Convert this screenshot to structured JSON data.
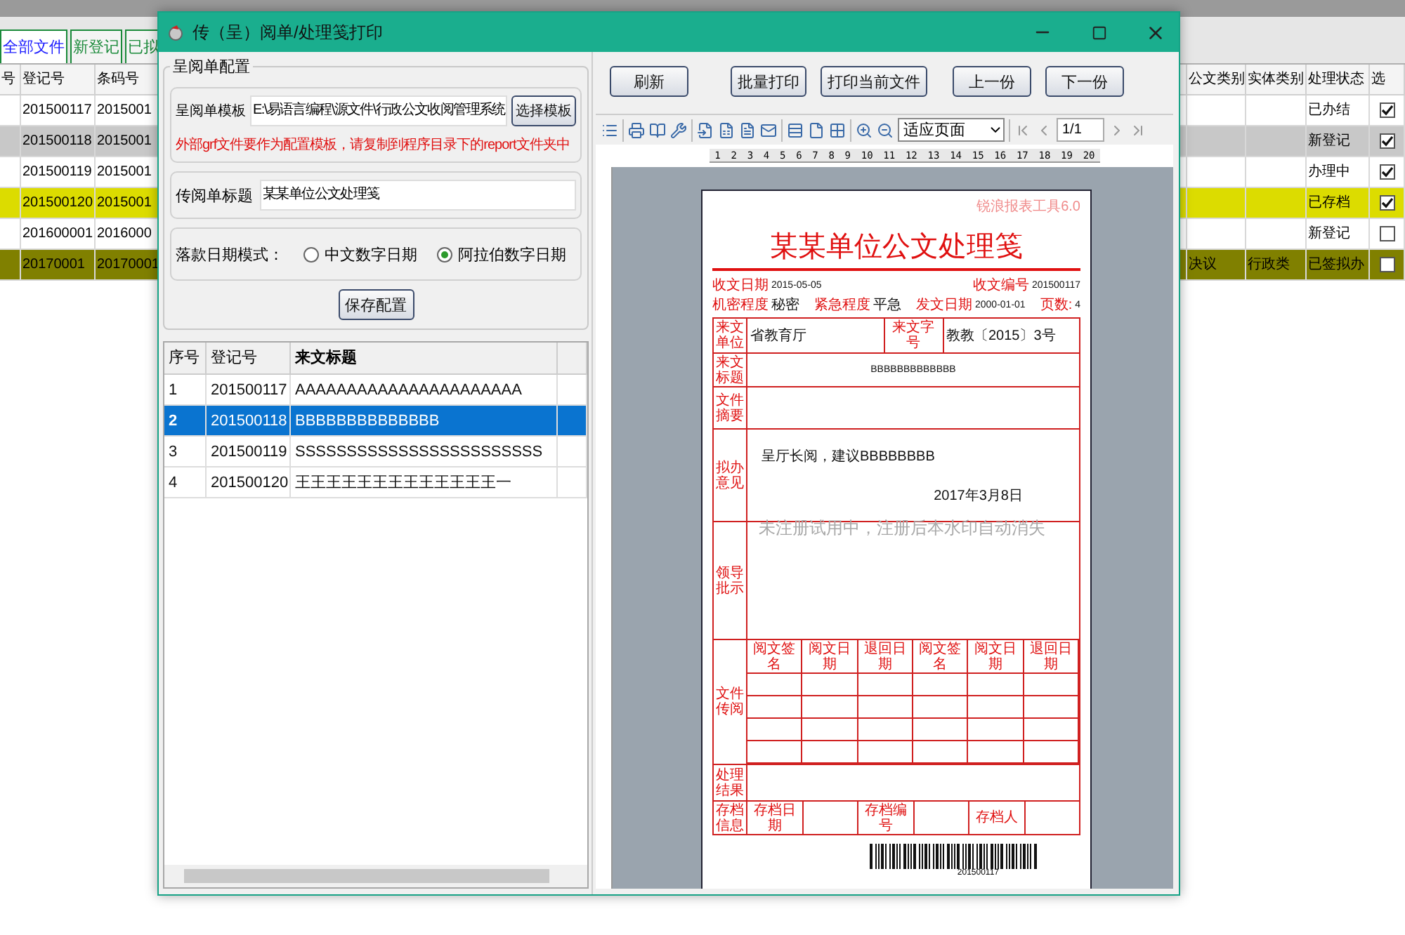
{
  "background_app": {
    "tabs": [
      {
        "label": "全部文件",
        "selected": true
      },
      {
        "label": "新登记",
        "selected": false
      },
      {
        "label": "已拟",
        "selected": false
      }
    ],
    "left_columns": [
      "号",
      "登记号",
      "条码号"
    ],
    "right_columns": [
      "公文类别",
      "实体类别",
      "处理状态",
      "选"
    ],
    "rows": [
      {
        "color": "#ffffff",
        "reg_no": "201500117",
        "barcode": "2015001",
        "status": "已办结",
        "checked": true
      },
      {
        "color": "#c8c8c8",
        "reg_no": "201500118",
        "barcode": "2015001",
        "status": "新登记",
        "checked": true
      },
      {
        "color": "#ffffff",
        "reg_no": "201500119",
        "barcode": "2015001",
        "status": "办理中",
        "checked": true
      },
      {
        "color": "#dcdc00",
        "reg_no": "201500120",
        "barcode": "2015001",
        "status": "已存档",
        "checked": true
      },
      {
        "color": "#ffffff",
        "reg_no": "201600001",
        "barcode": "2016000",
        "status": "新登记",
        "checked": false
      },
      {
        "color": "#808000",
        "reg_no": "20170001",
        "barcode": "20170001",
        "doc_category": "决议",
        "entity_category": "行政类",
        "status": "已签拟办",
        "checked": false
      }
    ]
  },
  "dialog": {
    "title": "传（呈）阅单/处理笺打印",
    "config": {
      "group_title": "呈阅单配置",
      "template_label": "呈阅单模板",
      "template_path": "E:\\易语言编程\\源文件\\行政公文收阅管理系统",
      "select_button": "选择模板",
      "hint": "外部grf文件要作为配置模板，请复制到程序目录下的report文件夹中",
      "title_label": "传阅单标题",
      "title_value": "某某单位公文处理笺",
      "date_mode_label": "落款日期模式：",
      "date_modes": [
        {
          "label": "中文数字日期",
          "selected": false
        },
        {
          "label": "阿拉伯数字日期",
          "selected": true
        }
      ],
      "save_button": "保存配置"
    },
    "list": {
      "columns": [
        "序号",
        "登记号",
        "来文标题"
      ],
      "rows": [
        {
          "index": "1",
          "reg_no": "201500117",
          "title": "AAAAAAAAAAAAAAAAAAAAAA",
          "selected": false
        },
        {
          "index": "2",
          "reg_no": "201500118",
          "title": "BBBBBBBBBBBBBB",
          "selected": true
        },
        {
          "index": "3",
          "reg_no": "201500119",
          "title": "SSSSSSSSSSSSSSSSSSSSSSSS",
          "selected": false
        },
        {
          "index": "4",
          "reg_no": "201500120",
          "title": "王王王王王王王王王王王王王一",
          "selected": false
        }
      ]
    },
    "preview": {
      "buttons": [
        "刷新",
        "批量打印",
        "打印当前文件",
        "上一份",
        "下一份"
      ],
      "zoom_select": "适应页面",
      "page_field": "1/1",
      "ruler_labels": [
        "1",
        "2",
        "3",
        "4",
        "5",
        "6",
        "7",
        "8",
        "9",
        "10",
        "11",
        "12",
        "13",
        "14",
        "15",
        "16",
        "17",
        "18",
        "19",
        "20"
      ],
      "document": {
        "brand": "锐浪报表工具6.0",
        "heading": "某某单位公文处理笺",
        "line1": [
          {
            "label": "收文日期",
            "value": "2015-05-05"
          },
          {
            "label": "收文编号",
            "value": "201500117"
          }
        ],
        "line2": [
          {
            "label": "机密程度",
            "value": "秘密"
          },
          {
            "label": "紧急程度",
            "value": "平急"
          },
          {
            "label": "发文日期",
            "value": "2000-01-01"
          },
          {
            "label": "页数:",
            "value": "4"
          }
        ],
        "source": [
          {
            "label": "来文单位",
            "value": "省教育厅"
          },
          {
            "label": "来文字号",
            "value": "教教〔2015〕3号"
          }
        ],
        "source_title": {
          "label": "来文标题",
          "value": "BBBBBBBBBBBBB"
        },
        "abstract_label": "文件摘要",
        "proposal": {
          "label": "拟办意见",
          "value": "呈厅长阅，建议BBBBBBBB",
          "date": "2017年3月8日"
        },
        "instruction_label": "领导批示",
        "circulation": {
          "label": "文件传阅",
          "columns": [
            "阅文签名",
            "阅文日期",
            "退回日期",
            "阅文签名",
            "阅文日期",
            "退回日期"
          ]
        },
        "result_label": "处理结果",
        "archive": {
          "label": "存档信息",
          "fields": [
            "存档日期",
            "存档编号",
            "存档人"
          ]
        },
        "watermark": "未注册试用中，注册后本水印自动消失",
        "barcode_text": "201500117"
      }
    }
  }
}
